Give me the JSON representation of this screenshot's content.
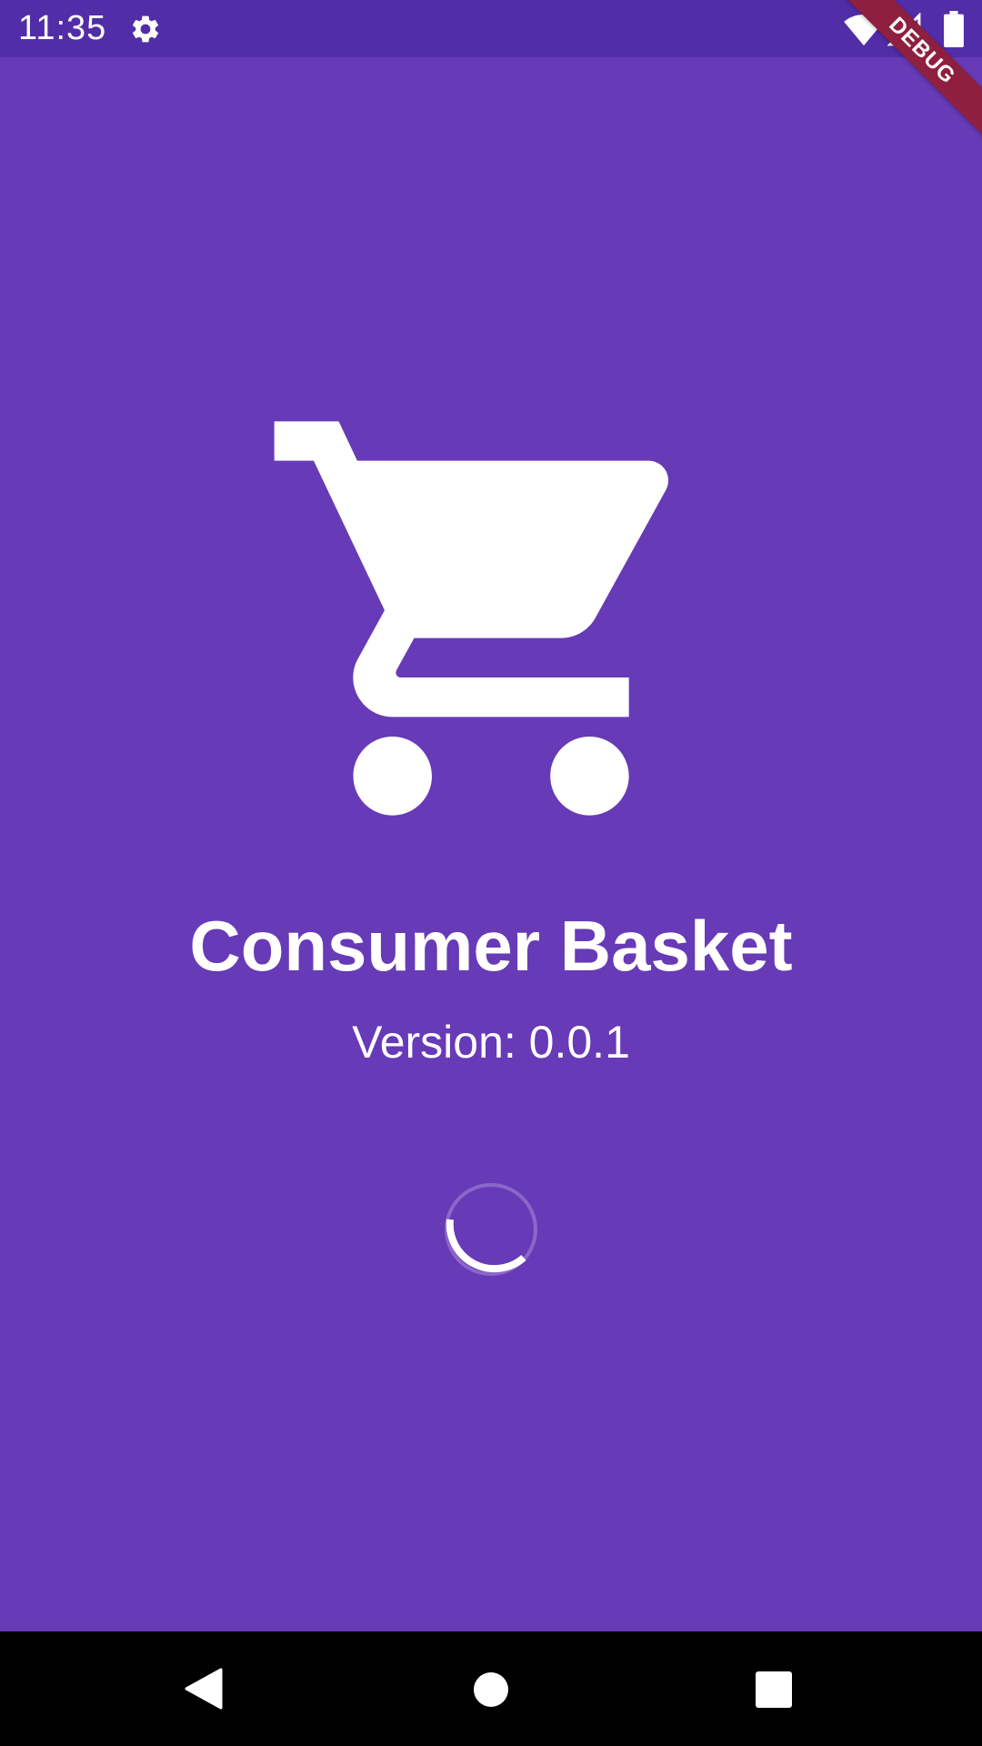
{
  "status_bar": {
    "time": "11:35",
    "icons": [
      "gear-icon",
      "wifi-icon",
      "signal-icon",
      "battery-icon"
    ],
    "background": "#512da8"
  },
  "debug_banner": {
    "label": "DEBUG",
    "color": "#8e1f3e"
  },
  "splash": {
    "icon": "shopping-cart-icon",
    "title": "Consumer Basket",
    "version": "Version: 0.0.1",
    "background": "#673ab7",
    "foreground": "#ffffff"
  },
  "loading_indicator": {
    "type": "circular-progress",
    "state": "indeterminate"
  },
  "navigation_bar": {
    "buttons": [
      "back-icon",
      "home-icon",
      "recents-icon"
    ],
    "background": "#000000"
  }
}
